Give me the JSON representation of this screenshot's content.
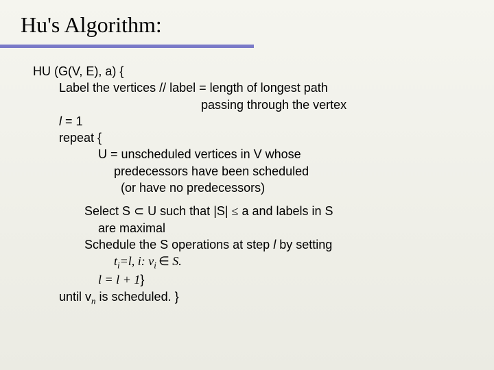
{
  "title": "Hu's Algorithm:",
  "sig": "HU (G(V, E), a) {",
  "step1a": "Label the vertices // label = length of longest path",
  "step1b": "passing through the vertex",
  "step2": "= 1",
  "step3": "repeat {",
  "step4a": "U = unscheduled vertices in V whose",
  "step4b": "predecessors have been scheduled",
  "step4c": "(or have no predecessors)",
  "step5a_1": "Select S ",
  "step5a_2": " U such that  |S| ",
  "step5a_3": " a  and labels in S",
  "step5b": "are maximal",
  "step6a": "Schedule the S operations at step ",
  "step6b": " by setting",
  "step7_1": "=l, i: v",
  "step7_2": " S.",
  "step8_2": " = ",
  "step8_3": " + 1",
  "step8_4": "}",
  "step9_1": "until v",
  "step9_2": " is scheduled. }"
}
